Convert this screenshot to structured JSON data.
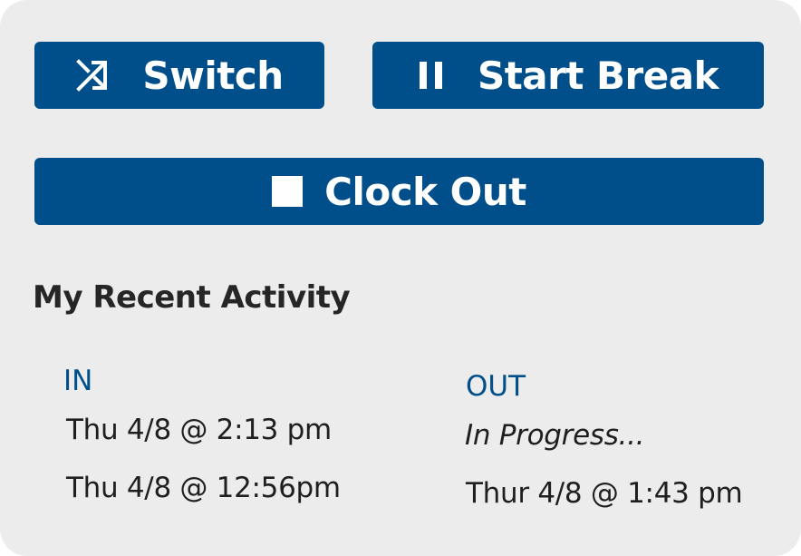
{
  "colors": {
    "primary": "#004f8a",
    "card_background": "#ececec",
    "text": "#1f1f1f",
    "heading": "#262626"
  },
  "actions": {
    "switch": {
      "label": "Switch",
      "icon": "shuffle-icon"
    },
    "start_break": {
      "label": "Start Break",
      "icon": "pause-icon"
    },
    "clock_out": {
      "label": "Clock Out",
      "icon": "stop-icon"
    }
  },
  "recent_activity": {
    "title": "My Recent Activity",
    "in": {
      "header": "IN",
      "entries": [
        "Thu 4/8 @ 2:13 pm",
        "Thu 4/8 @ 12:56pm"
      ]
    },
    "out": {
      "header": "OUT",
      "entries": [
        "In Progress...",
        "Thur 4/8 @ 1:43 pm"
      ]
    }
  }
}
